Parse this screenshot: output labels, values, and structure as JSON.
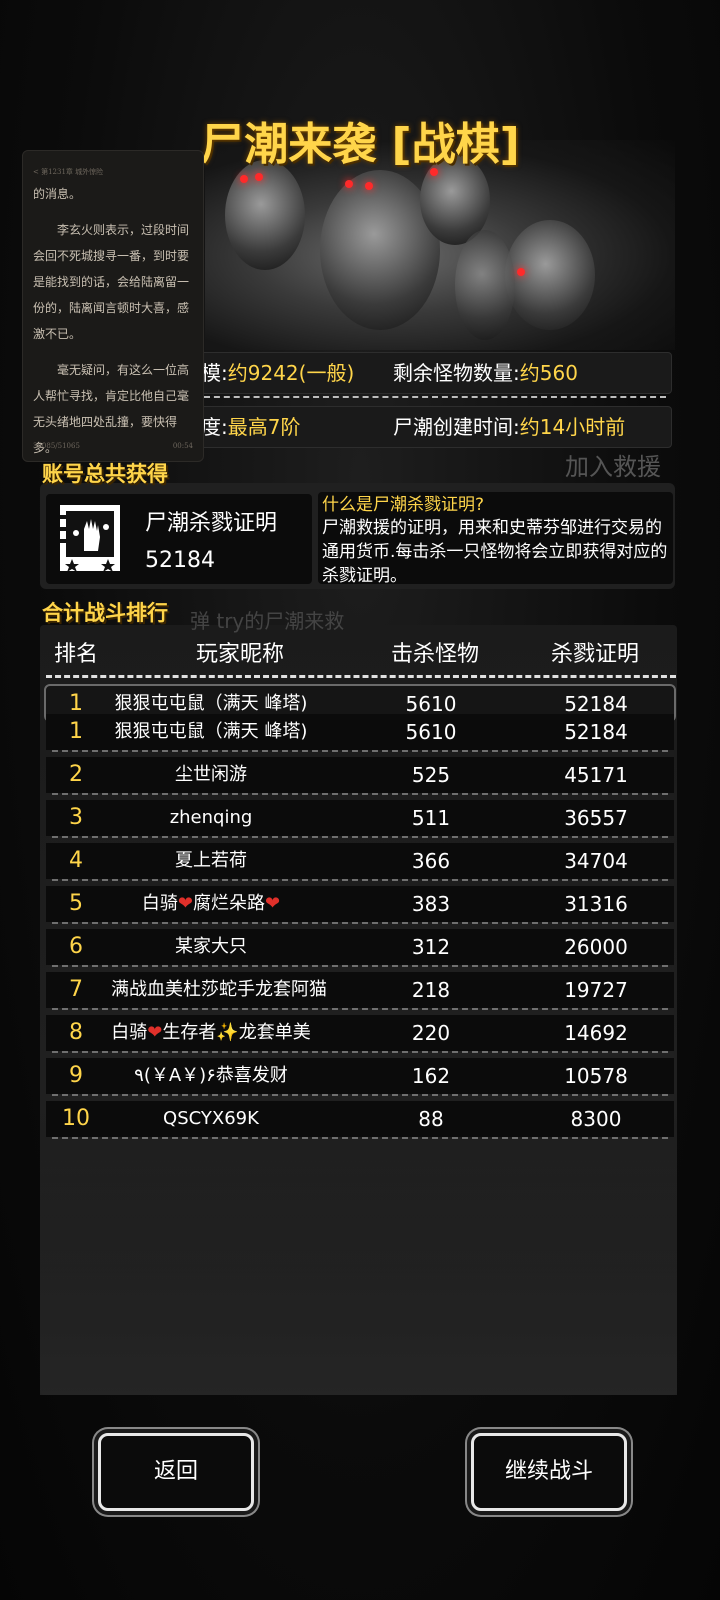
{
  "title": "尸潮来袭 [战棋]",
  "overlay_reader": {
    "header": "< 第1231章 城外惊险",
    "paragraphs": [
      "的消息。",
      "李玄火则表示，过段时间会回不死城搜寻一番，到时要是能找到的话，会给陆离留一份的，陆离闻言顿时大喜，感激不已。",
      "毫无疑问，有这么一位高人帮忙寻找，肯定比他自己毫无头绪地四处乱撞，要快得多。"
    ],
    "footer_left": "36085/51065",
    "footer_right": "00:54"
  },
  "info": {
    "scale_label": "模:",
    "scale_value": "约9242(一般)",
    "remaining_label": "剩余怪物数量:",
    "remaining_value": "约560",
    "difficulty_label": "度:",
    "difficulty_value": "最高7阶",
    "created_label": "尸潮创建时间:",
    "created_value": "约14小时前",
    "faint_join": "加入救援"
  },
  "account": {
    "section_title": "账号总共获得",
    "cert_name": "尸潮杀戮证明",
    "cert_value": "52184",
    "question_title": "什么是尸潮杀戮证明?",
    "question_body": "尸潮救援的证明，用来和史蒂芬邹进行交易的通用货币.每击杀一只怪物将会立即获得对应的杀戮证明。"
  },
  "ranking": {
    "section_title": "合计战斗排行",
    "faint_behind": "弹 try的尸潮来救",
    "headers": [
      "排名",
      "玩家昵称",
      "击杀怪物",
      "杀戮证明"
    ],
    "mine": {
      "rank": "1",
      "name": "狠狠屯屯鼠（满天 峰塔)",
      "kills": "5610",
      "cert": "52184"
    },
    "rows": [
      {
        "rank": "1",
        "name": "狠狠屯屯鼠（满天 峰塔)",
        "kills": "5610",
        "cert": "52184"
      },
      {
        "rank": "2",
        "name": "尘世闲游",
        "kills": "525",
        "cert": "45171"
      },
      {
        "rank": "3",
        "name": "zhenqing",
        "kills": "511",
        "cert": "36557"
      },
      {
        "rank": "4",
        "name": "夏上若荷",
        "kills": "366",
        "cert": "34704"
      },
      {
        "rank": "5",
        "name_a": "白骑",
        "name_b": "腐烂朵路",
        "kills": "383",
        "cert": "31316"
      },
      {
        "rank": "6",
        "name": "某家大只",
        "kills": "312",
        "cert": "26000"
      },
      {
        "rank": "7",
        "name": "满战血美杜莎蛇手龙套阿猫",
        "kills": "218",
        "cert": "19727"
      },
      {
        "rank": "8",
        "name_a": "白骑",
        "name_b": "生存者",
        "name_c": "龙套单美",
        "kills": "220",
        "cert": "14692"
      },
      {
        "rank": "9",
        "name": "٩(￥A￥)۶恭喜发财",
        "kills": "162",
        "cert": "10578"
      },
      {
        "rank": "10",
        "name": "QSCYX69K",
        "kills": "88",
        "cert": "8300"
      }
    ]
  },
  "buttons": {
    "back": "返回",
    "continue": "继续战斗"
  },
  "colors": {
    "accent_gold": "#ffd54a",
    "background": "#0d0d0d",
    "heart_red": "#e0302a",
    "eye_red": "#ff2a2a"
  },
  "icons": [
    "heart-icon",
    "sparkle-icon",
    "kill-certificate-icon"
  ]
}
